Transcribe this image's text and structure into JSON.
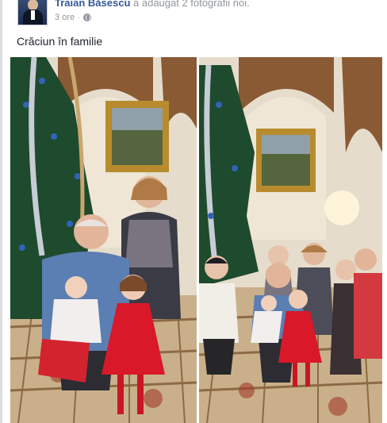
{
  "post": {
    "author": "Traian Băsescu",
    "action": "a adăugat 2 fotografii noi.",
    "time": "3 ore",
    "separator": "·",
    "privacy_icon": "globe-icon",
    "caption": "Crăciun în familie"
  },
  "photos": [
    {
      "name": "family-christmas-photo-1",
      "content": "photo"
    },
    {
      "name": "family-christmas-photo-2",
      "content": "photo"
    }
  ],
  "colors": {
    "author_link": "#365899",
    "meta_text": "#90949c",
    "background": "#ffffff"
  }
}
